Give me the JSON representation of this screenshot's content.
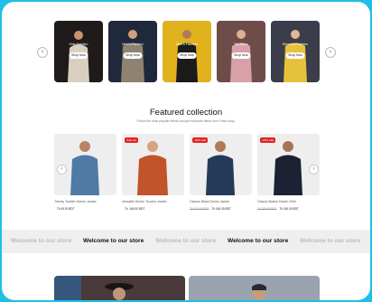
{
  "categories": [
    {
      "title": "Kids Fashion",
      "button": "Shop Now",
      "bg": "#1f1b1b"
    },
    {
      "title": "Men's Fashion",
      "button": "Shop Now",
      "bg": "#20283c"
    },
    {
      "title": "Men's Fashion",
      "button": "Shop Now",
      "bg": "#e0b21e"
    },
    {
      "title": "Top Sales",
      "button": "Shop Now",
      "bg": "#6e4c4a"
    },
    {
      "title": "Women's Fashion",
      "button": "Shop Now",
      "bg": "#3b3d4a"
    }
  ],
  "carousel": {
    "prev_icon": "‹",
    "next_icon": "›"
  },
  "featured": {
    "title": "Featured collection",
    "subtitle": "Follow the most popular trends and get exclusive items from Fosta shop.",
    "prev_icon": "‹",
    "next_icon": "›",
    "products": [
      {
        "name": "Trendy Toddler Denim Jacket",
        "badge": "",
        "old_price": "",
        "price": "Tk 45.00 BDT"
      },
      {
        "name": "Versatile Denim Trucker Jacket",
        "badge": "Sold out",
        "old_price": "",
        "price": "Tk. 160.00 BDT"
      },
      {
        "name": "Classic Black Denim Jacket",
        "badge": "-20% sale",
        "old_price": "Tk 200.00 BDT",
        "price": "Tk 160.00 BDT"
      },
      {
        "name": "Classic Button Denim Shirt",
        "badge": "-20% sale",
        "old_price": "Tk 200.00 BDT",
        "price": "Tk 160.00 BDT"
      }
    ]
  },
  "marquee": {
    "text": "Welcome to our store"
  },
  "colors": {
    "frame": "#1fc0e6",
    "badge": "#e02424"
  }
}
